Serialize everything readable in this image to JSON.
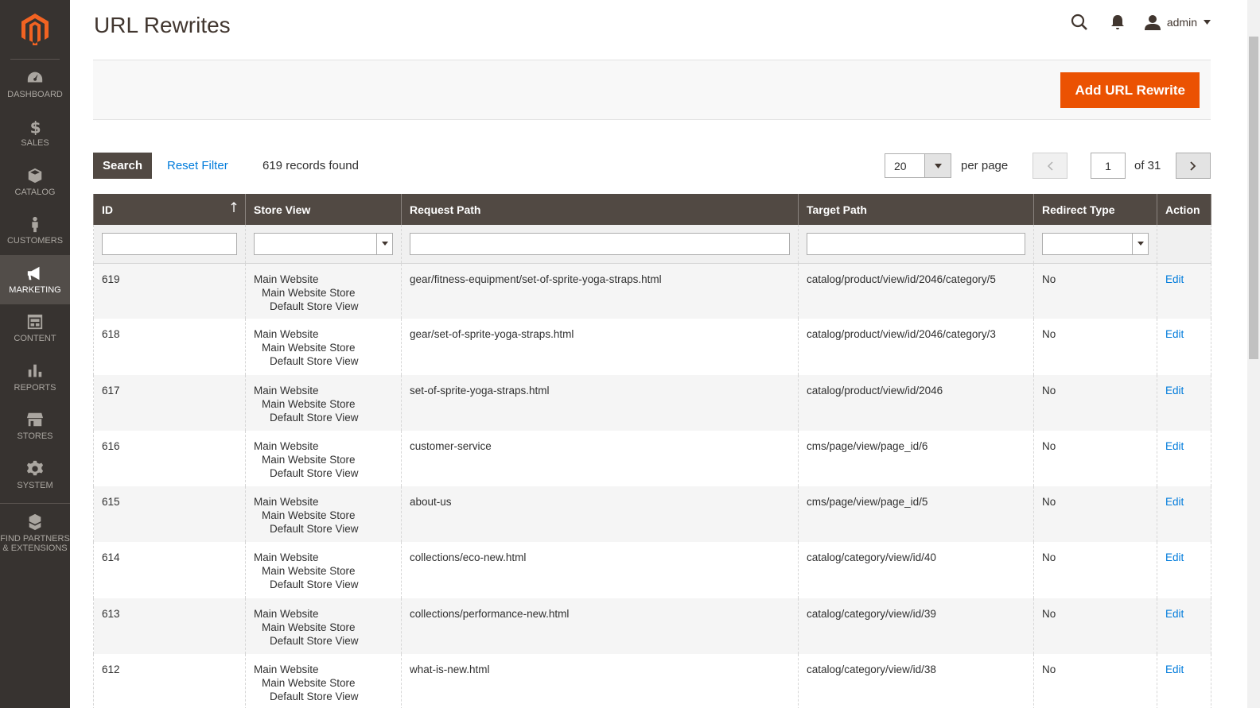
{
  "header": {
    "title": "URL Rewrites",
    "user": "admin"
  },
  "sidebar": {
    "items": [
      {
        "label": "DASHBOARD",
        "icon": "dashboard-icon"
      },
      {
        "label": "SALES",
        "icon": "dollar-icon"
      },
      {
        "label": "CATALOG",
        "icon": "cube-icon"
      },
      {
        "label": "CUSTOMERS",
        "icon": "person-icon"
      },
      {
        "label": "MARKETING",
        "icon": "megaphone-icon",
        "active": true
      },
      {
        "label": "CONTENT",
        "icon": "layout-icon"
      },
      {
        "label": "REPORTS",
        "icon": "bar-chart-icon"
      },
      {
        "label": "STORES",
        "icon": "storefront-icon"
      },
      {
        "label": "SYSTEM",
        "icon": "gear-icon"
      },
      {
        "label": "FIND PARTNERS & EXTENSIONS",
        "icon": "boxes-icon"
      }
    ]
  },
  "actions": {
    "add_label": "Add URL Rewrite"
  },
  "toolbar": {
    "search_label": "Search",
    "reset_label": "Reset Filter",
    "records_text": "619 records found",
    "per_page_value": "20",
    "per_page_label": "per page",
    "current_page": "1",
    "total_pages_text": "of 31"
  },
  "grid": {
    "columns": [
      "ID",
      "Store View",
      "Request Path",
      "Target Path",
      "Redirect Type",
      "Action"
    ],
    "rows": [
      {
        "id": "619",
        "sv1": "Main Website",
        "sv2": "Main Website Store",
        "sv3": "Default Store View",
        "request": "gear/fitness-equipment/set-of-sprite-yoga-straps.html",
        "target": "catalog/product/view/id/2046/category/5",
        "redirect": "No",
        "action": "Edit"
      },
      {
        "id": "618",
        "sv1": "Main Website",
        "sv2": "Main Website Store",
        "sv3": "Default Store View",
        "request": "gear/set-of-sprite-yoga-straps.html",
        "target": "catalog/product/view/id/2046/category/3",
        "redirect": "No",
        "action": "Edit"
      },
      {
        "id": "617",
        "sv1": "Main Website",
        "sv2": "Main Website Store",
        "sv3": "Default Store View",
        "request": "set-of-sprite-yoga-straps.html",
        "target": "catalog/product/view/id/2046",
        "redirect": "No",
        "action": "Edit"
      },
      {
        "id": "616",
        "sv1": "Main Website",
        "sv2": "Main Website Store",
        "sv3": "Default Store View",
        "request": "customer-service",
        "target": "cms/page/view/page_id/6",
        "redirect": "No",
        "action": "Edit"
      },
      {
        "id": "615",
        "sv1": "Main Website",
        "sv2": "Main Website Store",
        "sv3": "Default Store View",
        "request": "about-us",
        "target": "cms/page/view/page_id/5",
        "redirect": "No",
        "action": "Edit"
      },
      {
        "id": "614",
        "sv1": "Main Website",
        "sv2": "Main Website Store",
        "sv3": "Default Store View",
        "request": "collections/eco-new.html",
        "target": "catalog/category/view/id/40",
        "redirect": "No",
        "action": "Edit"
      },
      {
        "id": "613",
        "sv1": "Main Website",
        "sv2": "Main Website Store",
        "sv3": "Default Store View",
        "request": "collections/performance-new.html",
        "target": "catalog/category/view/id/39",
        "redirect": "No",
        "action": "Edit"
      },
      {
        "id": "612",
        "sv1": "Main Website",
        "sv2": "Main Website Store",
        "sv3": "Default Store View",
        "request": "what-is-new.html",
        "target": "catalog/category/view/id/38",
        "redirect": "No",
        "action": "Edit"
      }
    ]
  },
  "colors": {
    "accent": "#eb5202",
    "sidebar": "#373330",
    "header_row": "#514943",
    "link": "#007bdb"
  }
}
